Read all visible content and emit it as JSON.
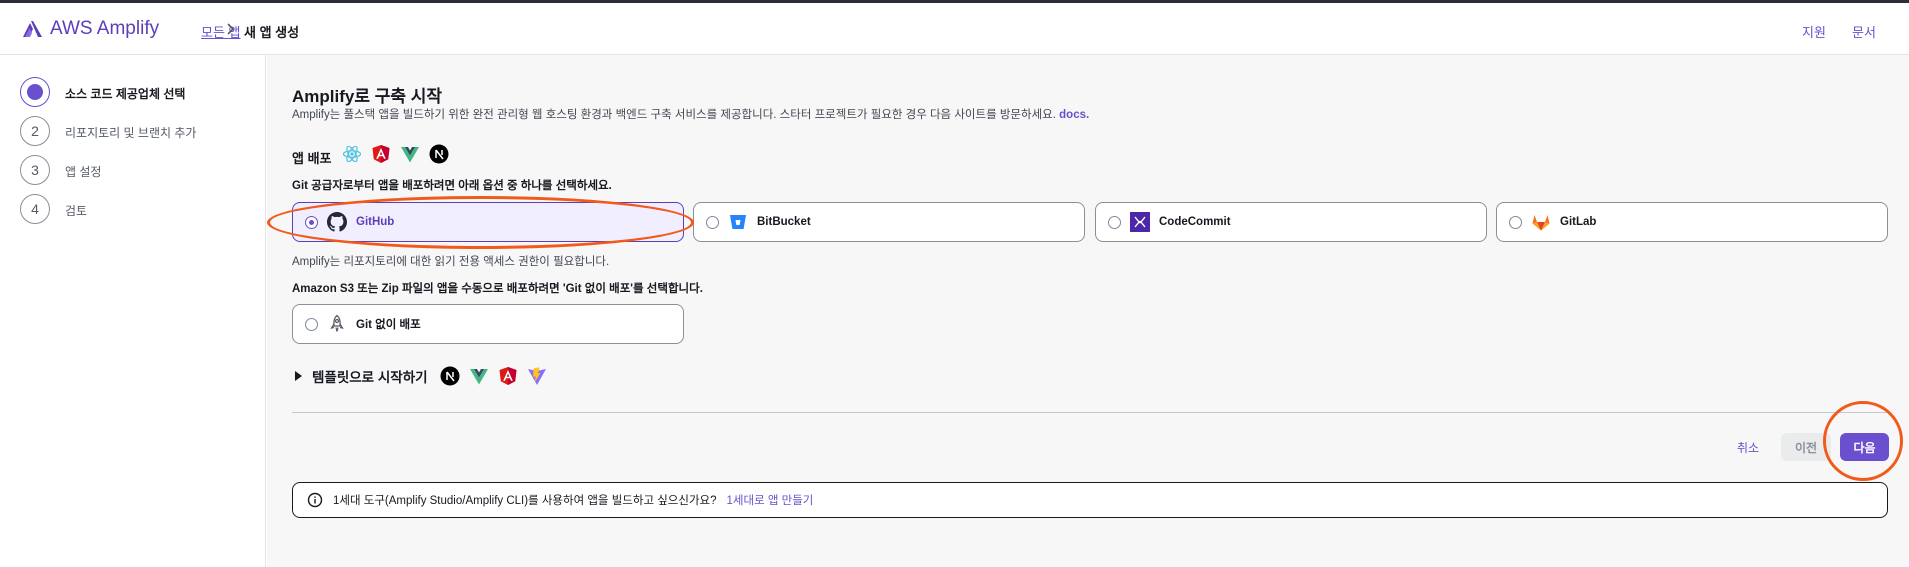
{
  "header": {
    "logo_text": "AWS Amplify",
    "breadcrumb_link": "모든 앱",
    "breadcrumb_current": "새 앱 생성",
    "support_link": "지원",
    "docs_link": "문서"
  },
  "steps": [
    {
      "number": "",
      "label": "소스 코드 제공업체 선택",
      "active": true
    },
    {
      "number": "2",
      "label": "리포지토리 및 브랜치 추가",
      "active": false
    },
    {
      "number": "3",
      "label": "앱 설정",
      "active": false
    },
    {
      "number": "4",
      "label": "검토",
      "active": false
    }
  ],
  "main": {
    "title": "Amplify로 구축 시작",
    "description": "Amplify는 풀스택 앱을 빌드하기 위한 완전 관리형 웹 호스팅 환경과 백엔드 구축 서비스를 제공합니다. 스타터 프로젝트가 필요한 경우 다음 사이트를 방문하세요.",
    "description_link": "docs.",
    "deploy_title": "앱 배포",
    "git_instruction": "Git 공급자로부터 앱을 배포하려면 아래 옵션 중 하나를 선택하세요.",
    "providers": [
      {
        "label": "GitHub",
        "icon": "github-icon",
        "selected": true
      },
      {
        "label": "BitBucket",
        "icon": "bitbucket-icon",
        "selected": false
      },
      {
        "label": "CodeCommit",
        "icon": "codecommit-icon",
        "selected": false
      },
      {
        "label": "GitLab",
        "icon": "gitlab-icon",
        "selected": false
      }
    ],
    "access_note": "Amplify는 리포지토리에 대한 읽기 전용 액세스 권한이 필요합니다.",
    "s3_instruction": "Amazon S3 또는 Zip 파일의 앱을 수동으로 배포하려면 'Git 없이 배포'를 선택합니다.",
    "nogit_label": "Git 없이 배포",
    "template_label": "템플릿으로 시작하기"
  },
  "actions": {
    "cancel": "취소",
    "previous": "이전",
    "next": "다음"
  },
  "info": {
    "text": "1세대 도구(Amplify Studio/Amplify CLI)를 사용하여 앱을 빌드하고 싶으신가요?",
    "link": "1세대로 앱 만들기"
  },
  "colors": {
    "accent": "#6a4fcf",
    "annotation": "#f25a1c"
  }
}
